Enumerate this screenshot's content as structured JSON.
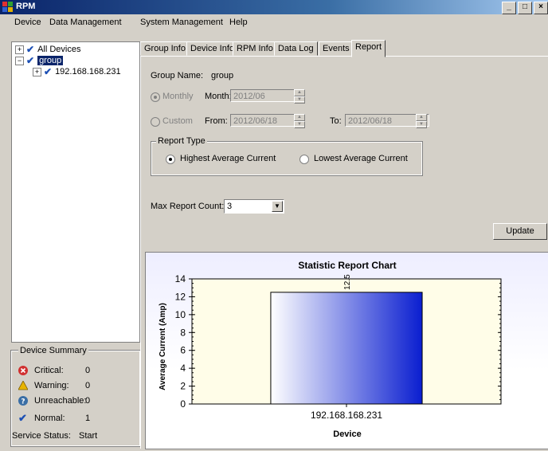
{
  "window": {
    "title": "RPM"
  },
  "menu": [
    "Device",
    "Data Management",
    "System Management",
    "Help"
  ],
  "tree": {
    "items": [
      {
        "label": "All Devices"
      },
      {
        "label": "group"
      },
      {
        "label": "192.168.168.231"
      }
    ]
  },
  "summary": {
    "title": "Device Summary",
    "rows": [
      {
        "label": "Critical:",
        "value": "0",
        "icon": "critical-icon",
        "color": "#d03030"
      },
      {
        "label": "Warning:",
        "value": "0",
        "icon": "warning-icon",
        "color": "#e8b400"
      },
      {
        "label": "Unreachable:",
        "value": "0",
        "icon": "unreachable-icon",
        "color": "#3a6ea5"
      },
      {
        "label": "Normal:",
        "value": "1",
        "icon": "normal-icon",
        "color": "#1c4fb4"
      }
    ],
    "service_status_label": "Service Status:",
    "service_status_value": "Start"
  },
  "tabs": [
    "Group Info",
    "Device Info",
    "RPM Info",
    "Data Log",
    "Events",
    "Report"
  ],
  "active_tab": "Report",
  "report": {
    "group_name_label": "Group Name:",
    "group_name_value": "group",
    "monthly_label": "Monthly",
    "month_label": "Month:",
    "month_value": "2012/06",
    "custom_label": "Custom",
    "from_label": "From:",
    "from_value": "2012/06/18",
    "to_label": "To:",
    "to_value": "2012/06/18",
    "report_type_legend": "Report Type",
    "highest_label": "Highest Average Current",
    "lowest_label": "Lowest Average Current",
    "max_count_label": "Max Report Count:",
    "max_count_value": "3",
    "update_label": "Update"
  },
  "chart_data": {
    "type": "bar",
    "title": "Statistic Report Chart",
    "xlabel": "Device",
    "ylabel": "Average Current (Amp)",
    "categories": [
      "192.168.168.231"
    ],
    "values": [
      12.5
    ],
    "value_labels": [
      "12.5"
    ],
    "ylim": [
      0,
      14
    ],
    "yticks": [
      0,
      2,
      4,
      6,
      8,
      10,
      12,
      14
    ],
    "colors": {
      "bar_start": "#ffffff",
      "bar_end": "#0a1ed0",
      "plot_bg": "#fffde8"
    }
  }
}
